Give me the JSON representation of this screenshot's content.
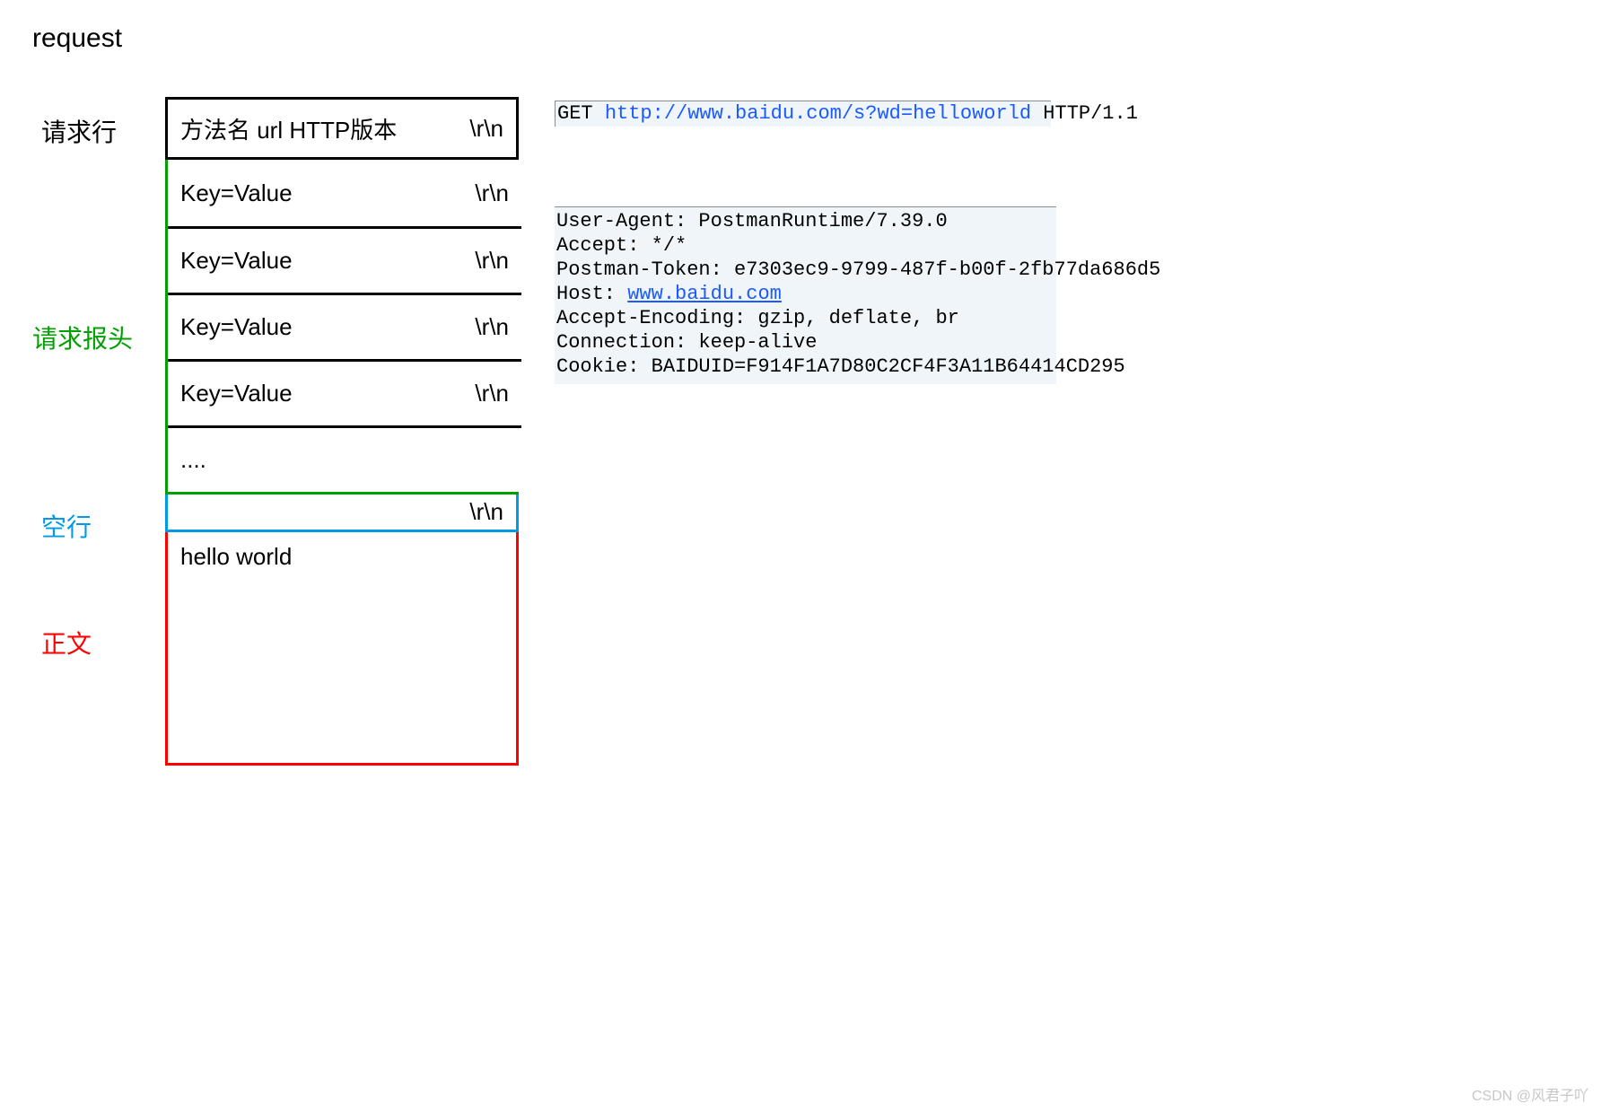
{
  "title": "request",
  "labels": {
    "request_line": "请求行",
    "headers": "请求报头",
    "empty_line": "空行",
    "body": "正文"
  },
  "crlf": "\\r\\n",
  "boxes": {
    "request_line": "方法名  url  HTTP版本",
    "header_rows": [
      "Key=Value",
      "Key=Value",
      "Key=Value",
      "Key=Value",
      "...."
    ],
    "empty": "",
    "body": "hello world"
  },
  "raw_request_line": {
    "method": "GET",
    "space1": " ",
    "url": "http://www.baidu.com/s?wd=helloworld",
    "space2": " ",
    "version": "HTTP/1.1"
  },
  "raw_headers": {
    "lines": [
      {
        "k": "User-Agent",
        "v": "PostmanRuntime/7.39.0"
      },
      {
        "k": "Accept",
        "v": "*/*"
      },
      {
        "k": "Postman-Token",
        "v": "e7303ec9-9799-487f-b00f-2fb77da686d5"
      },
      {
        "k": "Host",
        "v": "www.baidu.com",
        "link": true
      },
      {
        "k": "Accept-Encoding",
        "v": "gzip, deflate, br"
      },
      {
        "k": "Connection",
        "v": "keep-alive"
      },
      {
        "k": "Cookie",
        "v": "BAIDUID=F914F1A7D80C2CF4F3A11B64414CD295"
      }
    ]
  },
  "watermark": "CSDN @风君子吖"
}
